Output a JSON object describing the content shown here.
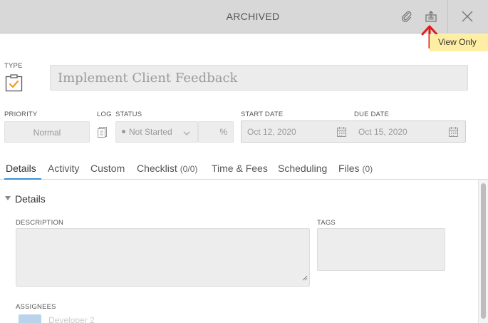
{
  "header": {
    "title": "ARCHIVED",
    "icons": [
      "paperclip-icon",
      "export-icon",
      "close-icon"
    ]
  },
  "tooltip": {
    "text": "View Only"
  },
  "type": {
    "label": "TYPE",
    "icon": "task-clipboard-icon"
  },
  "title_input": {
    "value": "Implement Client Feedback"
  },
  "priority": {
    "label": "PRIORITY",
    "value": "Normal"
  },
  "log": {
    "label": "LOG"
  },
  "status": {
    "label": "STATUS",
    "value": "Not Started",
    "percent_placeholder": "%"
  },
  "dates": {
    "start_label": "START DATE",
    "start_value": "Oct 12, 2020",
    "due_label": "DUE DATE",
    "due_value": "Oct 15, 2020"
  },
  "tabs": [
    {
      "label": "Details",
      "count": ""
    },
    {
      "label": "Activity",
      "count": ""
    },
    {
      "label": "Custom",
      "count": ""
    },
    {
      "label": "Checklist",
      "count": "(0/0)"
    },
    {
      "label": "Time & Fees",
      "count": ""
    },
    {
      "label": "Scheduling",
      "count": ""
    },
    {
      "label": "Files",
      "count": "(0)"
    }
  ],
  "details": {
    "heading": "Details",
    "description_label": "DESCRIPTION",
    "tags_label": "TAGS",
    "assignees_label": "ASSIGNEES",
    "assignee_name": "Developer 2"
  },
  "colors": {
    "header_bg": "#d8d8d8",
    "tooltip_bg": "#fdeea3",
    "accent_blue": "#3a8fd6",
    "task_orange": "#f39a1e",
    "arrow_red": "#e01b1b"
  }
}
